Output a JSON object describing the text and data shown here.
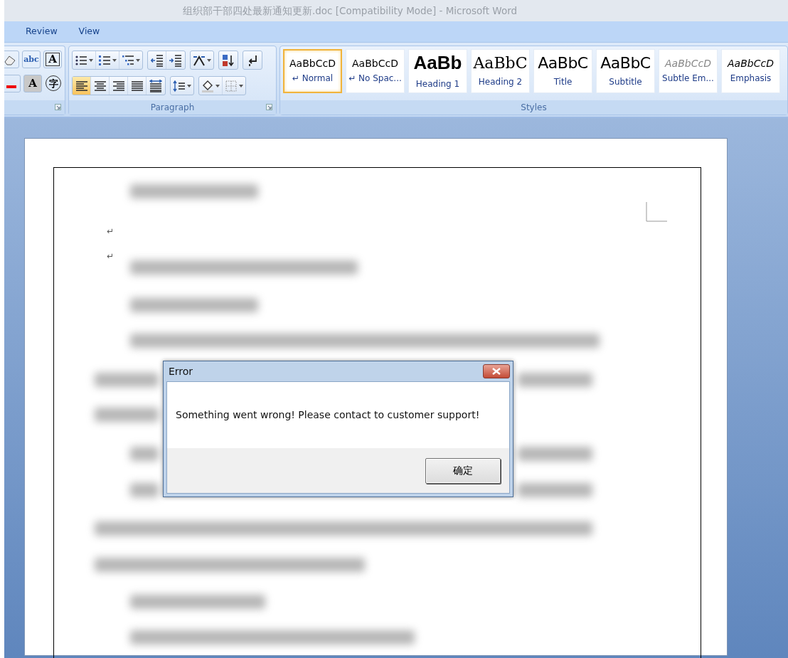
{
  "window": {
    "title": "组织部干部四处最新通知更新.doc [Compatibility Mode] - Microsoft Word"
  },
  "ribbon_tabs": [
    {
      "label": "Review"
    },
    {
      "label": "View"
    }
  ],
  "font_group": {
    "rows": [
      [
        {
          "kind": "eraser"
        },
        {
          "kind": "abc",
          "glyph": "abc"
        },
        {
          "kind": "boxed",
          "glyph": "A"
        }
      ],
      [
        {
          "kind": "color"
        },
        {
          "kind": "shaded",
          "glyph": "A"
        },
        {
          "kind": "circled",
          "glyph": "字"
        }
      ]
    ]
  },
  "paragraph_group": {
    "label": "Paragraph",
    "rows": [
      [
        [
          {
            "kind": "bullets",
            "dropdown": true,
            "selected": false
          },
          {
            "kind": "numbering",
            "dropdown": true,
            "selected": false
          },
          {
            "kind": "multilevel",
            "dropdown": true,
            "selected": false
          }
        ],
        [
          {
            "kind": "outdent",
            "dropdown": false,
            "selected": false
          },
          {
            "kind": "indent",
            "dropdown": false,
            "selected": false
          }
        ],
        [
          {
            "kind": "asian",
            "dropdown": true,
            "selected": false
          }
        ],
        [
          {
            "kind": "sort",
            "dropdown": false,
            "selected": false
          }
        ],
        [
          {
            "kind": "marks",
            "dropdown": false,
            "selected": false
          }
        ]
      ],
      [
        [
          {
            "kind": "left",
            "dropdown": false,
            "selected": true
          },
          {
            "kind": "center",
            "dropdown": false,
            "selected": false
          },
          {
            "kind": "right",
            "dropdown": false,
            "selected": false
          },
          {
            "kind": "justify",
            "dropdown": false,
            "selected": false
          },
          {
            "kind": "distributed",
            "dropdown": false,
            "selected": false
          }
        ],
        [
          {
            "kind": "spacing",
            "dropdown": true,
            "selected": false
          }
        ],
        [
          {
            "kind": "shading",
            "dropdown": true,
            "selected": false
          },
          {
            "kind": "borders",
            "dropdown": true,
            "selected": false
          }
        ]
      ]
    ]
  },
  "styles_group": {
    "label": "Styles",
    "items": [
      {
        "kind": "normal",
        "preview": "AaBbCcD",
        "label": "↵ Normal",
        "selected": true
      },
      {
        "kind": "normal",
        "preview": "AaBbCcD",
        "label": "↵ No Spac...",
        "selected": false
      },
      {
        "kind": "heading1",
        "preview": "AaBb",
        "label": "Heading 1",
        "selected": false
      },
      {
        "kind": "heading2",
        "preview": "AaBbC",
        "label": "Heading 2",
        "selected": false
      },
      {
        "kind": "title",
        "preview": "AaBbC",
        "label": "Title",
        "selected": false
      },
      {
        "kind": "subtitle",
        "preview": "AaBbC",
        "label": "Subtitle",
        "selected": false
      },
      {
        "kind": "subtle",
        "preview": "AaBbCcD",
        "label": "Subtle Em...",
        "selected": false
      },
      {
        "kind": "emphasis",
        "preview": "AaBbCcD",
        "label": "Emphasis",
        "selected": false
      }
    ]
  },
  "document": {
    "paragraph_marks": [
      "↵",
      "↵"
    ]
  },
  "dialog": {
    "title": "Error",
    "message": "Something went wrong! Please contact to customer support!",
    "buttons": [
      "确定"
    ]
  }
}
